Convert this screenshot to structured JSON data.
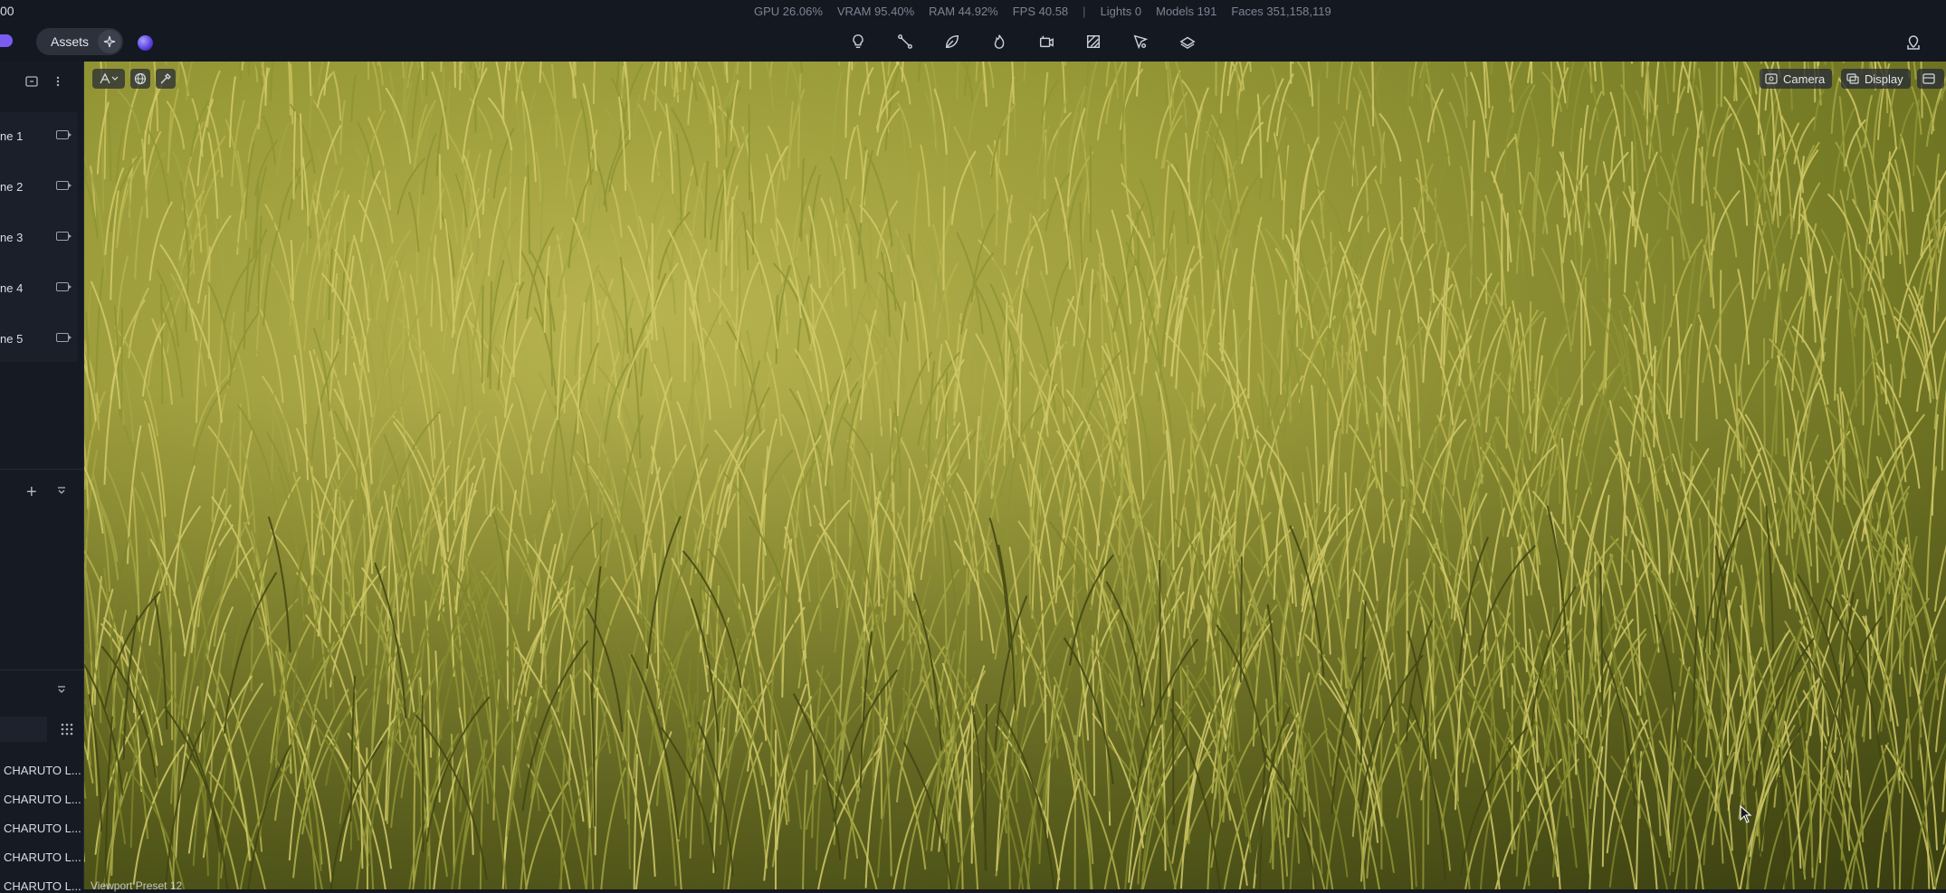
{
  "app": {
    "status_left": "00"
  },
  "stats": {
    "gpu": "GPU 26.06%",
    "vram": "VRAM 95.40%",
    "ram": "RAM 44.92%",
    "fps": "FPS 40.58",
    "separator": "|",
    "lights": "Lights 0",
    "models": "Models 191",
    "faces": "Faces 351,158,119"
  },
  "toolbar": {
    "assets_label": "Assets",
    "tools": [
      "light-icon",
      "path-icon",
      "leaf-icon",
      "fire-icon",
      "camera-rig-icon",
      "material-icon",
      "paint-icon",
      "terrain-icon"
    ]
  },
  "scenes": [
    {
      "label": "ne 1"
    },
    {
      "label": "ne 2"
    },
    {
      "label": "ne 3"
    },
    {
      "label": "ne 4"
    },
    {
      "label": "ne 5"
    }
  ],
  "assets": [
    {
      "label": "CHARUTO L..."
    },
    {
      "label": "CHARUTO L..."
    },
    {
      "label": "CHARUTO L..."
    },
    {
      "label": "CHARUTO L..."
    },
    {
      "label": "CHARUTO L..."
    }
  ],
  "viewport": {
    "camera_label": "Camera",
    "display_label": "Display",
    "footer_text": "Viewport Preset 12"
  },
  "colors": {
    "bg": "#141821",
    "panel": "#161a23",
    "accent": "#7a5cf0",
    "grass_light": "#c9c25e",
    "grass_dark": "#3f4412"
  }
}
